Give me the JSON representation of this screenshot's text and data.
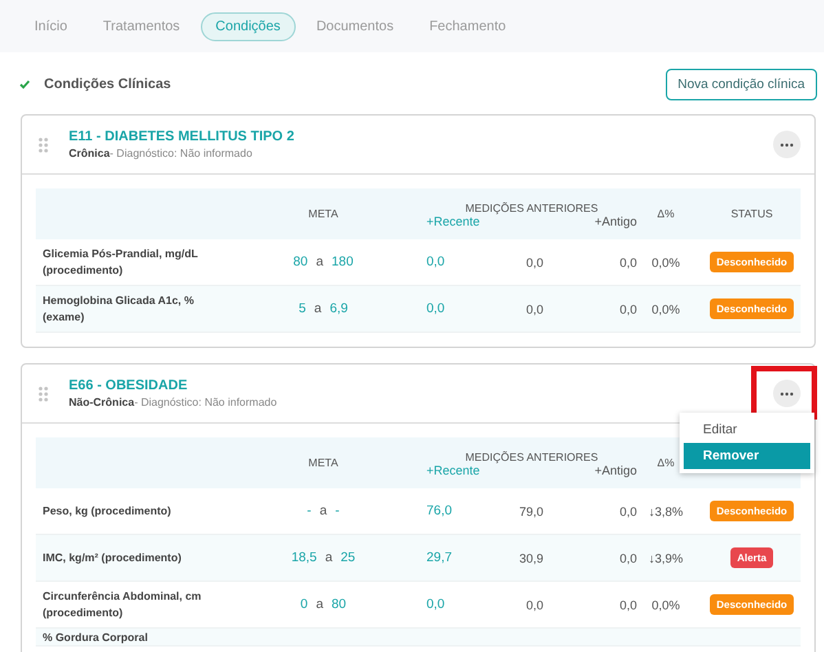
{
  "tabs": [
    {
      "label": "Início",
      "selected": false
    },
    {
      "label": "Tratamentos",
      "selected": false
    },
    {
      "label": "Condições",
      "selected": true
    },
    {
      "label": "Documentos",
      "selected": false
    },
    {
      "label": "Fechamento",
      "selected": false
    }
  ],
  "section": {
    "title": "Condições Clínicas",
    "complete": true,
    "new_button": "Nova condição clínica"
  },
  "conditions": [
    {
      "title": "E11 - DIABETES MELLITUS TIPO 2",
      "subtitle": "**Crônica**- Diagnóstico: Não informado",
      "columns": {
        "meta": "META",
        "measurements": "MEDIÇÕES ANTERIORES",
        "recent": "+Recente",
        "oldest": "+Antigo",
        "delta": "Δ%",
        "status": "STATUS"
      },
      "rows": [
        {
          "name": "Glicemia Pós-Prandial, mg/dL (procedimento)",
          "meta_min": "80",
          "sep": "a",
          "meta_max": "180",
          "recent": "0,0",
          "previous": "0,0",
          "oldest": "0,0",
          "delta": "0,0%",
          "status": {
            "label": "Desconhecido",
            "kind": "unknown"
          }
        },
        {
          "name": "Hemoglobina Glicada A1c, % (exame)",
          "meta_min": "5",
          "sep": "a",
          "meta_max": "6,9",
          "recent": "0,0",
          "previous": "0,0",
          "oldest": "0,0",
          "delta": "0,0%",
          "status": {
            "label": "Desconhecido",
            "kind": "unknown"
          }
        }
      ]
    },
    {
      "title": "E66 - OBESIDADE",
      "subtitle": "**Não-Crônica**- Diagnóstico: Não informado",
      "menu_highlighted": true,
      "menu": [
        {
          "label": "Editar",
          "selected": false
        },
        {
          "label": "Remover",
          "selected": true
        }
      ],
      "columns": {
        "meta": "META",
        "measurements": "MEDIÇÕES ANTERIORES",
        "recent": "+Recente",
        "oldest": "+Antigo",
        "delta": "Δ%"
      },
      "rows": [
        {
          "name": "Peso, kg (procedimento)",
          "meta_min": "-",
          "sep": "a",
          "meta_max": "-",
          "recent": "76,0",
          "previous": "79,0",
          "oldest": "0,0",
          "delta": "↓3,8%",
          "status": {
            "label": "Desconhecido",
            "kind": "unknown"
          }
        },
        {
          "name": "IMC, kg/m² (procedimento)",
          "meta_min": "18,5",
          "sep": "a",
          "meta_max": "25",
          "recent": "29,7",
          "previous": "30,9",
          "oldest": "0,0",
          "delta": "↓3,9%",
          "status": {
            "label": "Alerta",
            "kind": "alert"
          }
        },
        {
          "name": "Circunferência Abdominal, cm (procedimento)",
          "meta_min": "0",
          "sep": "a",
          "meta_max": "80",
          "recent": "0,0",
          "previous": "0,0",
          "oldest": "0,0",
          "delta": "0,0%",
          "status": {
            "label": "Desconhecido",
            "kind": "unknown"
          }
        },
        {
          "name": "% Gordura Corporal"
        }
      ]
    }
  ]
}
